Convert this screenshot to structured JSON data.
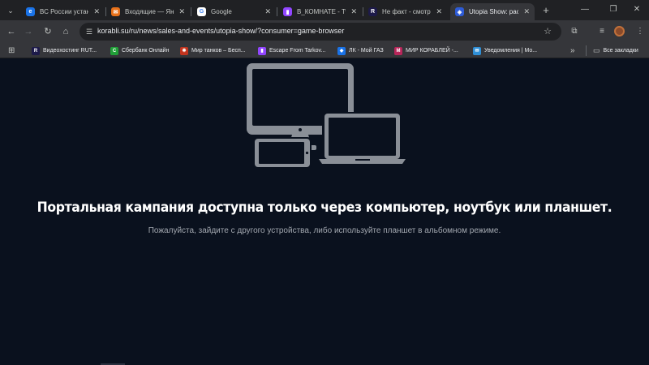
{
  "browser": {
    "tabs": [
      {
        "title": "ВС России устано",
        "favicon": "circle-e-icon",
        "color": "#1a73e8"
      },
      {
        "title": "Входящие — Янде",
        "favicon": "mail-icon",
        "color": "#e8711a"
      },
      {
        "title": "Google",
        "favicon": "google-icon",
        "color": "#ffffff"
      },
      {
        "title": "В_КОМНАТЕ - Twit",
        "favicon": "twitch-icon",
        "color": "#9146ff"
      },
      {
        "title": "Не факт - смотре",
        "favicon": "rutube-icon",
        "color": "#1d1a4a"
      },
      {
        "title": "Utopia Show: расс",
        "favicon": "shield-icon",
        "color": "#2d5bd6"
      }
    ],
    "active_tab": 5,
    "url": "korabli.su/ru/news/sales-and-events/utopia-show/?consumer=game-browser",
    "bookmarks": [
      {
        "title": "Видеохостинг RUT...",
        "color": "#1d1a4a",
        "glyph": "R"
      },
      {
        "title": "Сбербанк Онлайн",
        "color": "#21a038",
        "glyph": "С"
      },
      {
        "title": "Мир танков – Бесп...",
        "color": "#c2341e",
        "glyph": "✱"
      },
      {
        "title": "Escape From Tarkov...",
        "color": "#9146ff",
        "glyph": "▮"
      },
      {
        "title": "ЛК - Мой ГАЗ",
        "color": "#1a73e8",
        "glyph": "◆"
      },
      {
        "title": "МИР КОРАБЛЕЙ -...",
        "color": "#b8265a",
        "glyph": "M"
      },
      {
        "title": "Уведомления | Мо...",
        "color": "#2f8fd6",
        "glyph": "✉"
      }
    ],
    "all_bookmarks_label": "Все закладки"
  },
  "page": {
    "headline": "Портальная кампания доступна только через компьютер, ноутбук или планшет.",
    "subline": "Пожалуйста, зайдите с другого устройства, либо используйте планшет в альбомном режиме."
  }
}
